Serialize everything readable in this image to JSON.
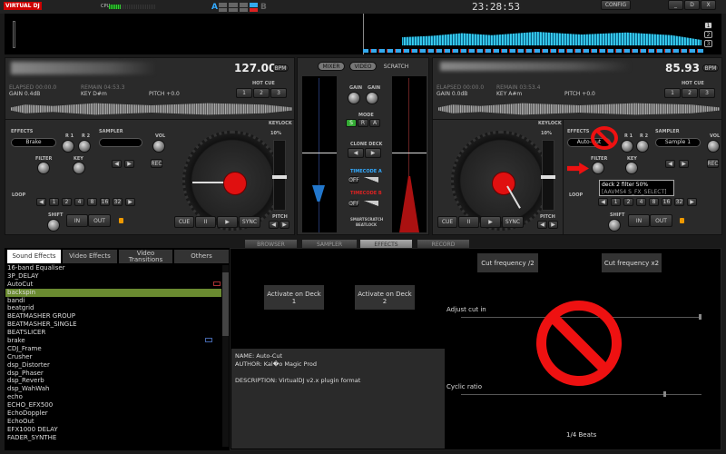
{
  "topbar": {
    "logo": "VIRTUAL DJ",
    "cpu_label": "CPU",
    "cpu_load": 0.25,
    "crossfader_a": "A",
    "crossfader_b": "B",
    "clock": "23:28:53",
    "config": "CONFIG",
    "minimize": "_",
    "maximize": "D",
    "close": "X"
  },
  "overview": {
    "deck_buttons": [
      "1",
      "2",
      "3"
    ]
  },
  "deck1": {
    "bpm": "127.00",
    "bpm_label": "BPM",
    "elapsed": "ELAPSED 00:00.0",
    "remain": "REMAIN 04:53.3",
    "gain": "GAIN 0.4dB",
    "key": "KEY D#m",
    "pitch": "PITCH +0.0",
    "hotcue_label": "HOT CUE",
    "hotcues": [
      "1",
      "2",
      "3"
    ],
    "effects_label": "EFFECTS",
    "effect_selected": "Brake",
    "r1": "R 1",
    "r2": "R 2",
    "filter": "FILTER",
    "key_label": "KEY",
    "sampler_label": "SAMPLER",
    "sampler_selected": "",
    "vol": "VOL",
    "rec": "REC",
    "loop_label": "LOOP",
    "loop_sizes": [
      "1",
      "2",
      "4",
      "8",
      "16",
      "32"
    ],
    "shift": "SHIFT",
    "in": "IN",
    "out": "OUT",
    "keylock": "KEYLOCK",
    "pitch_range": "10%",
    "pitch_label": "PITCH",
    "transport": [
      "CUE",
      "II",
      "▶",
      "SYNC"
    ]
  },
  "deck2": {
    "bpm": "85.93",
    "bpm_label": "BPM",
    "elapsed": "ELAPSED 00:00.0",
    "remain": "REMAIN 03:53.4",
    "gain": "GAIN 0.0dB",
    "key": "KEY A#m",
    "pitch": "PITCH +0.0",
    "hotcue_label": "HOT CUE",
    "hotcues": [
      "1",
      "2",
      "3"
    ],
    "effects_label": "EFFECTS",
    "effect_selected": "Auto-Cut",
    "r1": "R 1",
    "r2": "R 2",
    "filter": "FILTER",
    "key_label": "KEY",
    "sampler_label": "SAMPLER",
    "sampler_selected": "Sample 1",
    "vol": "VOL",
    "rec": "REC",
    "loop_label": "LOOP",
    "loop_sizes": [
      "1",
      "2",
      "4",
      "8",
      "16",
      "32"
    ],
    "shift": "SHIFT",
    "in": "IN",
    "out": "OUT",
    "keylock": "KEYLOCK",
    "pitch_range": "10%",
    "pitch_label": "PITCH",
    "transport": [
      "CUE",
      "II",
      "▶",
      "SYNC"
    ],
    "tooltip_line1": "deck 2 filter 50%",
    "tooltip_line2": "[AAVMS4 S_FX_SELECT]"
  },
  "mixer": {
    "tabs": [
      "MIXER",
      "VIDEO",
      "SCRATCH"
    ],
    "gain1": "GAIN",
    "gain2": "GAIN",
    "mode": "MODE",
    "mode_buttons": [
      "S",
      "R",
      "A"
    ],
    "clone_deck": "CLONE DECK",
    "timecode_a": "TIMECODE A",
    "timecode_b": "TIMECODE B",
    "off": "OFF",
    "smartscratch": "SMARTSCRATCH",
    "beatlock": "BEATLOCK"
  },
  "browser_tabs": [
    "BROWSER",
    "SAMPLER",
    "EFFECTS",
    "RECORD"
  ],
  "effects": {
    "tabs": [
      "Sound Effects",
      "Video Effects",
      "Video Transitions",
      "Others"
    ],
    "items": [
      "16-band Equaliser",
      "3P_DELAY",
      "AutoCut",
      "backspin",
      "bandi",
      "beatgrid",
      "BEATMASHER GROUP",
      "BEATMASHER_SINGLE",
      "BEATSLICER",
      "brake",
      "CDJ_Frame",
      "Crusher",
      "dsp_Distorter",
      "dsp_Phaser",
      "dsp_Reverb",
      "dsp_WahWah",
      "echo",
      "ECHO_EFX500",
      "EchoDoppler",
      "EchoOut",
      "EFX1000 DELAY",
      "FADER_SYNTHE"
    ],
    "selected_index": 3,
    "activate1": "Activate on Deck 1",
    "activate2": "Activate on Deck 2",
    "info_name": "NAME: Auto-Cut",
    "info_author": "AUTHOR: Kal�o Magic Prod",
    "info_desc": "DESCRIPTION: VirtualDJ v2.x plugin format",
    "cut_half": "Cut frequency /2",
    "cut_double": "Cut frequency x2",
    "adjust_label": "Adjust cut in",
    "adjust_value": 1.0,
    "cyclic_label": "Cyclic ratio",
    "cyclic_value": 0.85,
    "beats": "1/4 Beats"
  }
}
